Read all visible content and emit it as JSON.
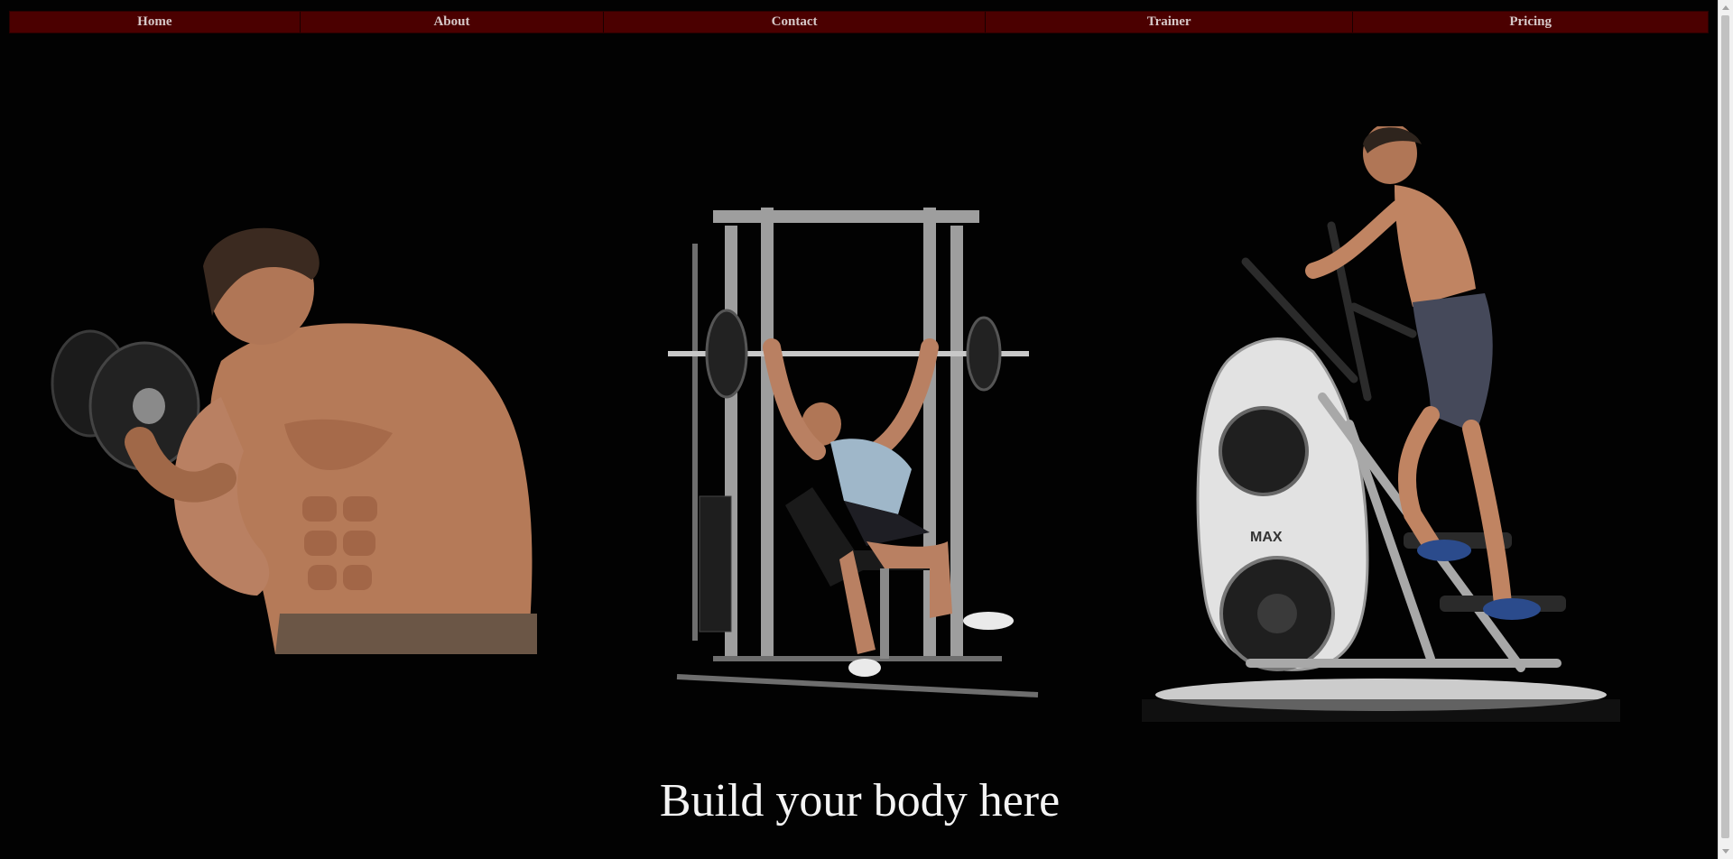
{
  "nav": {
    "items": [
      {
        "label": "Home"
      },
      {
        "label": "About"
      },
      {
        "label": "Contact"
      },
      {
        "label": "Trainer"
      },
      {
        "label": "Pricing"
      }
    ]
  },
  "main": {
    "headline": "Build your body here"
  },
  "colors": {
    "nav_background": "#4b0000",
    "page_background": "#020202",
    "nav_text": "#d6c8c8",
    "headline_text": "#f4f4f4"
  }
}
